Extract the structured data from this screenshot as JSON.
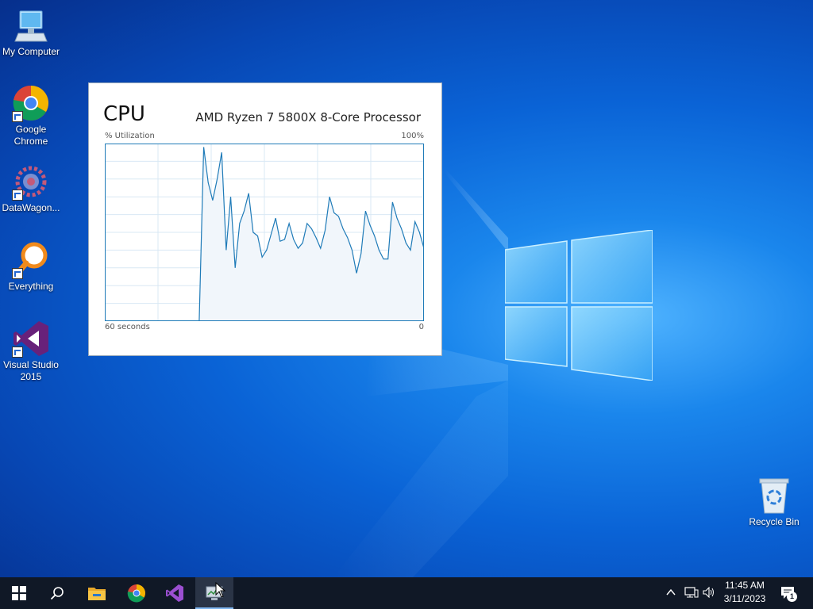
{
  "desktop": {
    "icons": [
      {
        "label": "My Computer",
        "icon": "computer-icon"
      },
      {
        "label": "Google\nChrome",
        "icon": "chrome-icon"
      },
      {
        "label": "DataWagon...",
        "icon": "datawagon-icon"
      },
      {
        "label": "Everything",
        "icon": "everything-search-icon"
      },
      {
        "label": "Visual Studio\n2015",
        "icon": "visual-studio-icon"
      },
      {
        "label": "Recycle Bin",
        "icon": "recycle-bin-icon"
      }
    ]
  },
  "cpu_widget": {
    "title": "CPU",
    "processor": "AMD Ryzen 7 5800X 8-Core Processor",
    "y_label": "% Utilization",
    "y_max_label": "100%",
    "x_left_label": "60 seconds",
    "x_right_label": "0"
  },
  "chart_data": {
    "type": "area",
    "title": "CPU",
    "xlabel": "",
    "ylabel": "% Utilization",
    "x_range_seconds": [
      60,
      0
    ],
    "ylim": [
      0,
      100
    ],
    "grid": true,
    "series": [
      {
        "values": [
          0,
          0,
          0,
          0,
          0,
          0,
          0,
          0,
          0,
          0,
          0,
          0,
          0,
          0,
          0,
          0,
          0,
          0,
          0,
          0,
          0,
          0,
          98,
          78,
          68,
          80,
          95,
          40,
          70,
          30,
          55,
          62,
          72,
          50,
          48,
          36,
          40,
          49,
          58,
          45,
          46,
          55,
          46,
          41,
          44,
          55,
          52,
          47,
          41,
          51,
          70,
          61,
          59,
          52,
          47,
          40,
          27,
          38,
          62,
          54,
          48,
          40,
          35,
          35,
          67,
          58,
          52,
          44,
          40,
          56,
          50,
          41
        ]
      }
    ],
    "line_color": "#1f7bb8",
    "fill_color": "#f1f6fb"
  },
  "taskbar": {
    "buttons": [
      {
        "name": "start-button",
        "icon": "windows-start-icon"
      },
      {
        "name": "search-button",
        "icon": "search-icon"
      },
      {
        "name": "file-explorer-button",
        "icon": "folder-icon"
      },
      {
        "name": "chrome-button",
        "icon": "chrome-icon"
      },
      {
        "name": "visual-studio-button",
        "icon": "visual-studio-icon"
      },
      {
        "name": "task-manager-button",
        "icon": "task-manager-icon"
      }
    ],
    "clock": {
      "time": "11:45 AM",
      "date": "3/11/2023"
    },
    "notification_count": "1"
  },
  "colors": {
    "taskbar": "#101826",
    "graph_border": "#1f7bb8",
    "graph_grid": "#d9e8f4"
  }
}
